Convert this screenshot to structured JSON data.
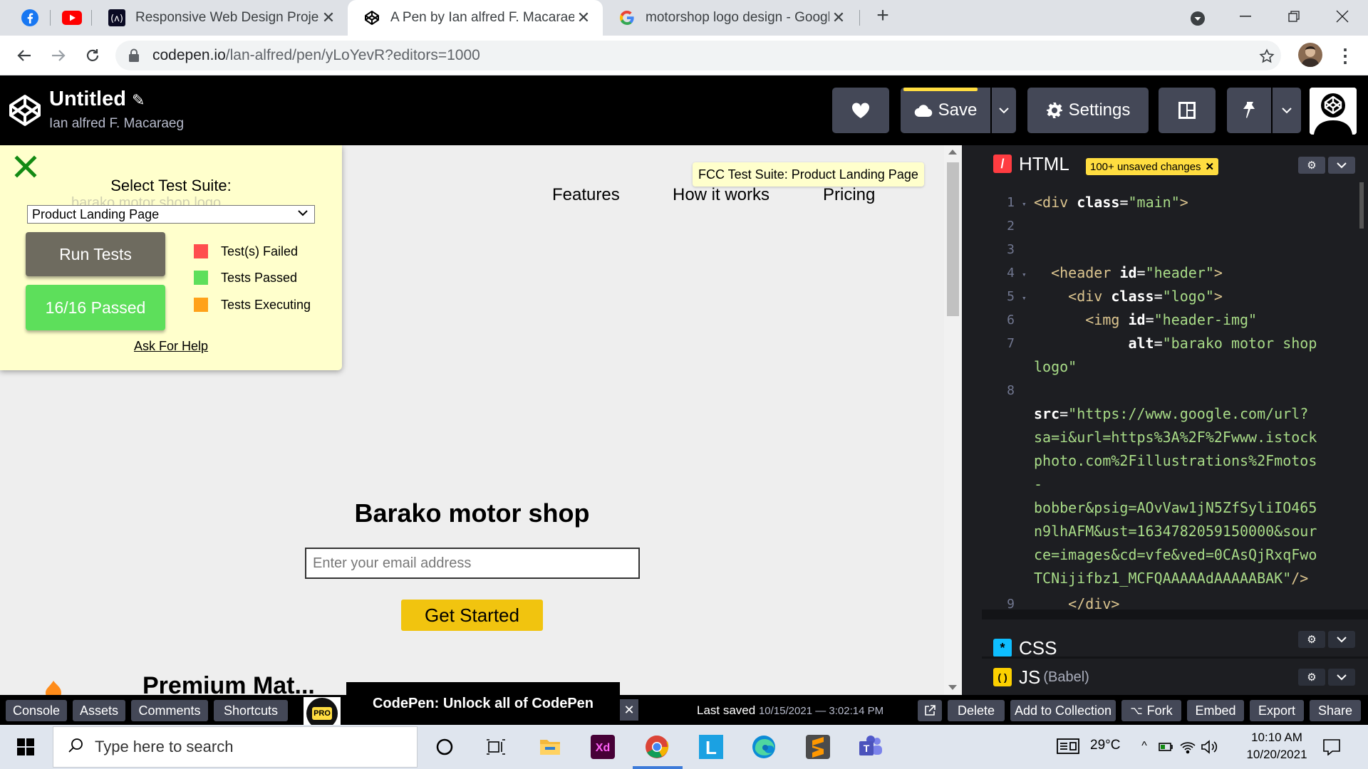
{
  "browser": {
    "tabs": [
      {
        "title": "Responsive Web Design Projects",
        "active": false
      },
      {
        "title": "A Pen by Ian alfred F. Macaraeg",
        "active": true
      },
      {
        "title": "motorshop logo design - Google",
        "active": false
      }
    ],
    "url_domain": "codepen.io",
    "url_path": "/lan-alfred/pen/yLoYevR?editors=1000"
  },
  "codepen": {
    "title": "Untitled",
    "author": "Ian alfred F. Macaraeg",
    "save_label": "Save",
    "settings_label": "Settings"
  },
  "test_panel": {
    "ghost_alt": "barako motor shop logo",
    "select_label": "Select Test Suite:",
    "selected_suite": "Product Landing Page",
    "run_label": "Run Tests",
    "passed_label": "16/16 Passed",
    "legend": [
      {
        "label": "Test(s) Failed",
        "color": "#ff4e4e"
      },
      {
        "label": "Tests Passed",
        "color": "#5ddf5b"
      },
      {
        "label": "Tests Executing",
        "color": "#ffa21a"
      }
    ],
    "help_label": "Ask For Help"
  },
  "preview": {
    "tooltip": "FCC Test Suite: Product Landing Page",
    "nav": [
      "Features",
      "How it works",
      "Pricing"
    ],
    "heading": "Barako motor shop",
    "email_placeholder": "Enter your email address",
    "cta_label": "Get Started",
    "next_heading": "Premium Mat..."
  },
  "editor": {
    "html_label": "HTML",
    "unsaved_label": "100+ unsaved changes",
    "css_label": "CSS",
    "js_label": "JS",
    "js_sub": "(Babel)",
    "line_numbers": [
      "1",
      "2",
      "3",
      "4",
      "5",
      "6",
      "7",
      "8",
      "9"
    ]
  },
  "statusbar": {
    "left_buttons": [
      "Console",
      "Assets",
      "Comments",
      "Shortcuts"
    ],
    "pro_text": "PRO",
    "promo": "CodePen: Unlock all of CodePen",
    "last_saved_label": "Last saved",
    "last_saved_value": "10/15/2021 — 3:02:14 PM",
    "right_buttons": [
      "Delete",
      "Add to Collection",
      "Fork",
      "Embed",
      "Export",
      "Share"
    ]
  },
  "taskbar": {
    "search_placeholder": "Type here to search",
    "temperature": "29°C",
    "time": "10:10 AM",
    "date": "10/20/2021"
  },
  "colors": {
    "codepen_black": "#000000",
    "button_gray": "#444857",
    "accent_yellow": "#ffdd40",
    "editor_bg": "#1d1e22"
  }
}
